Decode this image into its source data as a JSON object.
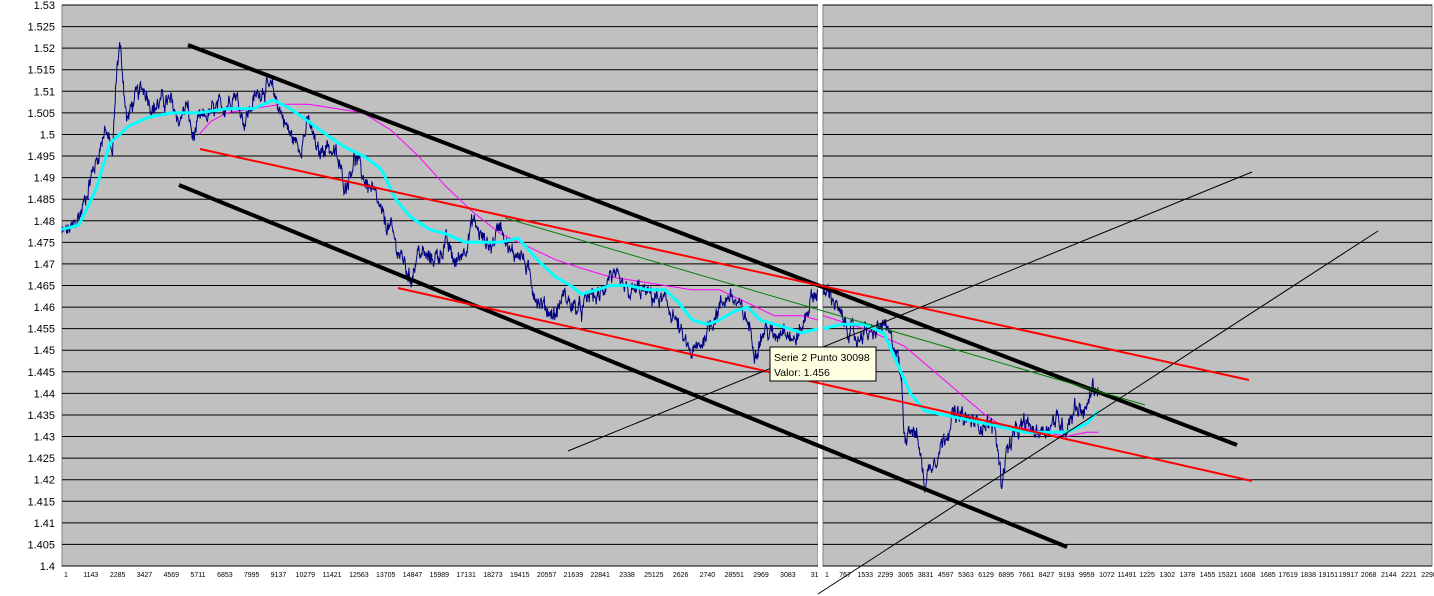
{
  "chart_data": {
    "type": "line",
    "title": "",
    "xlabel": "",
    "ylabel": "",
    "grid": true,
    "colors": {
      "plot_background": "#c0c0c0",
      "gridline": "#000000",
      "price": "#000080",
      "ma_fast": "#00ffff",
      "ma_slow": "#ff00ff",
      "channel_outer": "#000000",
      "channel_inner": "#ff0000",
      "trend": "#008000",
      "guide": "#000000"
    },
    "y_ticks": [
      "1.53",
      "1.525",
      "1.52",
      "1.515",
      "1.51",
      "1.505",
      "1.5",
      "1.495",
      "1.49",
      "1.485",
      "1.48",
      "1.475",
      "1.47",
      "1.465",
      "1.46",
      "1.455",
      "1.45",
      "1.445",
      "1.44",
      "1.435",
      "1.43",
      "1.425",
      "1.42",
      "1.415",
      "1.41",
      "1.405",
      "1.4"
    ],
    "ylim": [
      1.4,
      1.53
    ],
    "panels": [
      {
        "name": "left",
        "x_ticks": [
          "1",
          "1143",
          "2285",
          "3427",
          "4569",
          "5711",
          "6853",
          "7995",
          "9137",
          "10279",
          "11421",
          "12563",
          "13705",
          "14847",
          "15989",
          "17131",
          "18273",
          "19415",
          "20557",
          "21639",
          "22841",
          "2338",
          "25125",
          "2626",
          "2740",
          "28551",
          "2969",
          "3083",
          "31"
        ],
        "xlim": [
          0,
          31500
        ],
        "price_anchors": [
          [
            0,
            1.477
          ],
          [
            400,
            1.478
          ],
          [
            800,
            1.482
          ],
          [
            1200,
            1.49
          ],
          [
            1500,
            1.495
          ],
          [
            1800,
            1.502
          ],
          [
            2100,
            1.495
          ],
          [
            2285,
            1.515
          ],
          [
            2400,
            1.521
          ],
          [
            2550,
            1.513
          ],
          [
            2700,
            1.503
          ],
          [
            3000,
            1.508
          ],
          [
            3427,
            1.511
          ],
          [
            3800,
            1.506
          ],
          [
            4200,
            1.508
          ],
          [
            4569,
            1.507
          ],
          [
            4900,
            1.503
          ],
          [
            5200,
            1.507
          ],
          [
            5450,
            1.499
          ],
          [
            5711,
            1.503
          ],
          [
            6200,
            1.505
          ],
          [
            6853,
            1.507
          ],
          [
            7200,
            1.51
          ],
          [
            7600,
            1.503
          ],
          [
            7995,
            1.508
          ],
          [
            8400,
            1.511
          ],
          [
            8800,
            1.51
          ],
          [
            9137,
            1.505
          ],
          [
            9500,
            1.5
          ],
          [
            9900,
            1.497
          ],
          [
            10279,
            1.503
          ],
          [
            10700,
            1.495
          ],
          [
            11000,
            1.498
          ],
          [
            11421,
            1.495
          ],
          [
            11800,
            1.488
          ],
          [
            12200,
            1.495
          ],
          [
            12563,
            1.49
          ],
          [
            13000,
            1.486
          ],
          [
            13400,
            1.48
          ],
          [
            13705,
            1.478
          ],
          [
            14000,
            1.473
          ],
          [
            14300,
            1.47
          ],
          [
            14500,
            1.466
          ],
          [
            14847,
            1.473
          ],
          [
            15300,
            1.471
          ],
          [
            15700,
            1.472
          ],
          [
            15989,
            1.475
          ],
          [
            16400,
            1.47
          ],
          [
            16800,
            1.474
          ],
          [
            17131,
            1.48
          ],
          [
            17500,
            1.476
          ],
          [
            17900,
            1.474
          ],
          [
            18273,
            1.48
          ],
          [
            18700,
            1.472
          ],
          [
            19100,
            1.473
          ],
          [
            19415,
            1.468
          ],
          [
            19800,
            1.462
          ],
          [
            20100,
            1.46
          ],
          [
            20557,
            1.458
          ],
          [
            20900,
            1.463
          ],
          [
            21300,
            1.46
          ],
          [
            21639,
            1.459
          ],
          [
            22000,
            1.463
          ],
          [
            22400,
            1.462
          ],
          [
            22841,
            1.468
          ],
          [
            23200,
            1.465
          ],
          [
            23600,
            1.463
          ],
          [
            24000,
            1.464
          ],
          [
            24400,
            1.463
          ],
          [
            24800,
            1.462
          ],
          [
            25125,
            1.461
          ],
          [
            25500,
            1.458
          ],
          [
            25900,
            1.452
          ],
          [
            26260,
            1.449
          ],
          [
            26600,
            1.451
          ],
          [
            26900,
            1.455
          ],
          [
            27400,
            1.46
          ],
          [
            27800,
            1.463
          ],
          [
            28200,
            1.46
          ],
          [
            28551,
            1.457
          ],
          [
            28900,
            1.45
          ],
          [
            29300,
            1.455
          ],
          [
            29690,
            1.453
          ],
          [
            30100,
            1.456
          ],
          [
            30500,
            1.452
          ],
          [
            30830,
            1.455
          ],
          [
            31200,
            1.462
          ],
          [
            31500,
            1.464
          ]
        ],
        "ma_fast_anchors": [
          [
            0,
            1.478
          ],
          [
            700,
            1.479
          ],
          [
            1400,
            1.487
          ],
          [
            2000,
            1.498
          ],
          [
            2800,
            1.502
          ],
          [
            3600,
            1.504
          ],
          [
            4569,
            1.505
          ],
          [
            5711,
            1.505
          ],
          [
            6853,
            1.506
          ],
          [
            7995,
            1.506
          ],
          [
            8800,
            1.508
          ],
          [
            9500,
            1.506
          ],
          [
            10279,
            1.503
          ],
          [
            11000,
            1.5
          ],
          [
            11800,
            1.497
          ],
          [
            12563,
            1.495
          ],
          [
            13300,
            1.492
          ],
          [
            13900,
            1.485
          ],
          [
            14500,
            1.481
          ],
          [
            15300,
            1.478
          ],
          [
            15989,
            1.477
          ],
          [
            16800,
            1.475
          ],
          [
            17500,
            1.475
          ],
          [
            18273,
            1.475
          ],
          [
            19000,
            1.476
          ],
          [
            19800,
            1.471
          ],
          [
            20557,
            1.467
          ],
          [
            21200,
            1.465
          ],
          [
            21639,
            1.463
          ],
          [
            22300,
            1.464
          ],
          [
            22841,
            1.465
          ],
          [
            23600,
            1.465
          ],
          [
            24400,
            1.464
          ],
          [
            25125,
            1.464
          ],
          [
            25700,
            1.461
          ],
          [
            26260,
            1.457
          ],
          [
            26900,
            1.456
          ],
          [
            27400,
            1.457
          ],
          [
            28000,
            1.459
          ],
          [
            28551,
            1.46
          ],
          [
            29100,
            1.457
          ],
          [
            29690,
            1.456
          ],
          [
            30300,
            1.455
          ],
          [
            30830,
            1.454
          ],
          [
            31500,
            1.455
          ]
        ],
        "ma_slow_anchors": [
          [
            5711,
            1.5
          ],
          [
            6200,
            1.503
          ],
          [
            6853,
            1.505
          ],
          [
            7995,
            1.506
          ],
          [
            9137,
            1.507
          ],
          [
            10279,
            1.507
          ],
          [
            11421,
            1.506
          ],
          [
            12563,
            1.505
          ],
          [
            13705,
            1.501
          ],
          [
            14847,
            1.495
          ],
          [
            15989,
            1.488
          ],
          [
            17131,
            1.482
          ],
          [
            18273,
            1.477
          ],
          [
            19415,
            1.474
          ],
          [
            20557,
            1.471
          ],
          [
            21639,
            1.469
          ],
          [
            22841,
            1.467
          ],
          [
            24000,
            1.466
          ],
          [
            25125,
            1.465
          ],
          [
            26260,
            1.464
          ],
          [
            27400,
            1.464
          ],
          [
            28551,
            1.461
          ],
          [
            29690,
            1.458
          ],
          [
            30830,
            1.458
          ],
          [
            31500,
            1.457
          ]
        ]
      },
      {
        "name": "right",
        "x_ticks": [
          "1",
          "767",
          "1533",
          "2299",
          "3065",
          "3831",
          "4597",
          "5363",
          "6129",
          "6895",
          "7661",
          "8427",
          "9193",
          "9959",
          "1072",
          "11491",
          "1225",
          "1302",
          "1378",
          "1455",
          "15321",
          "1608",
          "1685",
          "17619",
          "1838",
          "19151",
          "19917",
          "2068",
          "2144",
          "2221",
          "2298"
        ],
        "xlim": [
          0,
          23000
        ],
        "price_anchors": [
          [
            0,
            1.462
          ],
          [
            250,
            1.464
          ],
          [
            450,
            1.461
          ],
          [
            700,
            1.457
          ],
          [
            1000,
            1.455
          ],
          [
            1300,
            1.452
          ],
          [
            1533,
            1.455
          ],
          [
            1800,
            1.453
          ],
          [
            2100,
            1.455
          ],
          [
            2299,
            1.456
          ],
          [
            2500,
            1.453
          ],
          [
            2800,
            1.45
          ],
          [
            3000,
            1.44
          ],
          [
            3065,
            1.43
          ],
          [
            3300,
            1.433
          ],
          [
            3600,
            1.429
          ],
          [
            3831,
            1.419
          ],
          [
            4100,
            1.424
          ],
          [
            4400,
            1.427
          ],
          [
            4597,
            1.43
          ],
          [
            4900,
            1.435
          ],
          [
            5363,
            1.434
          ],
          [
            5800,
            1.433
          ],
          [
            6129,
            1.433
          ],
          [
            6500,
            1.432
          ],
          [
            6750,
            1.419
          ],
          [
            6895,
            1.426
          ],
          [
            7200,
            1.43
          ],
          [
            7661,
            1.433
          ],
          [
            8000,
            1.431
          ],
          [
            8427,
            1.432
          ],
          [
            8800,
            1.434
          ],
          [
            9193,
            1.432
          ],
          [
            9500,
            1.437
          ],
          [
            9959,
            1.436
          ],
          [
            10200,
            1.442
          ],
          [
            10400,
            1.44
          ]
        ],
        "ma_fast_anchors": [
          [
            0,
            1.455
          ],
          [
            700,
            1.456
          ],
          [
            1533,
            1.456
          ],
          [
            2299,
            1.454
          ],
          [
            2800,
            1.447
          ],
          [
            3300,
            1.44
          ],
          [
            3831,
            1.436
          ],
          [
            4597,
            1.435
          ],
          [
            5363,
            1.434
          ],
          [
            6129,
            1.433
          ],
          [
            6895,
            1.432
          ],
          [
            7661,
            1.431
          ],
          [
            8427,
            1.431
          ],
          [
            9193,
            1.431
          ],
          [
            9959,
            1.433
          ],
          [
            10400,
            1.436
          ]
        ],
        "ma_slow_anchors": [
          [
            0,
            1.458
          ],
          [
            1533,
            1.455
          ],
          [
            2299,
            1.453
          ],
          [
            3065,
            1.451
          ],
          [
            3831,
            1.447
          ],
          [
            4597,
            1.443
          ],
          [
            5363,
            1.439
          ],
          [
            6129,
            1.435
          ],
          [
            6895,
            1.432
          ],
          [
            7661,
            1.432
          ],
          [
            8427,
            1.431
          ],
          [
            9193,
            1.43
          ],
          [
            9959,
            1.431
          ],
          [
            10400,
            1.431
          ]
        ]
      }
    ],
    "tooltip": {
      "line1": "Serie 2 Punto 30098",
      "line2": "Valor: 1.456"
    }
  }
}
